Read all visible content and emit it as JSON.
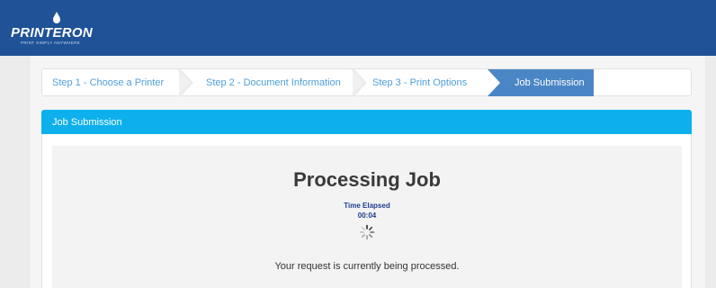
{
  "header": {
    "logo_text": "PRINTERON",
    "logo_tagline": "PRINT SIMPLY ANYWHERE"
  },
  "steps": [
    {
      "label": "Step 1 - Choose a Printer",
      "state": "done"
    },
    {
      "label": "Step 2 - Document Information",
      "state": "done"
    },
    {
      "label": "Step 3 - Print Options",
      "state": "done"
    },
    {
      "label": "Job Submission",
      "state": "active"
    }
  ],
  "panel": {
    "title": "Job Submission",
    "heading": "Processing Job",
    "elapsed_label": "Time Elapsed",
    "elapsed_value": "00:04",
    "status_message": "Your request is currently being processed."
  },
  "colors": {
    "header_bg": "#1f5297",
    "panel_header_bg": "#0db0ec",
    "active_step_bg": "#4a86c5",
    "inactive_step_text": "#4f9fd8",
    "elapsed_text": "#1b3e8f"
  },
  "icons": {
    "logo": "printeron-drop-logo",
    "spinner": "loading-spinner-icon"
  }
}
